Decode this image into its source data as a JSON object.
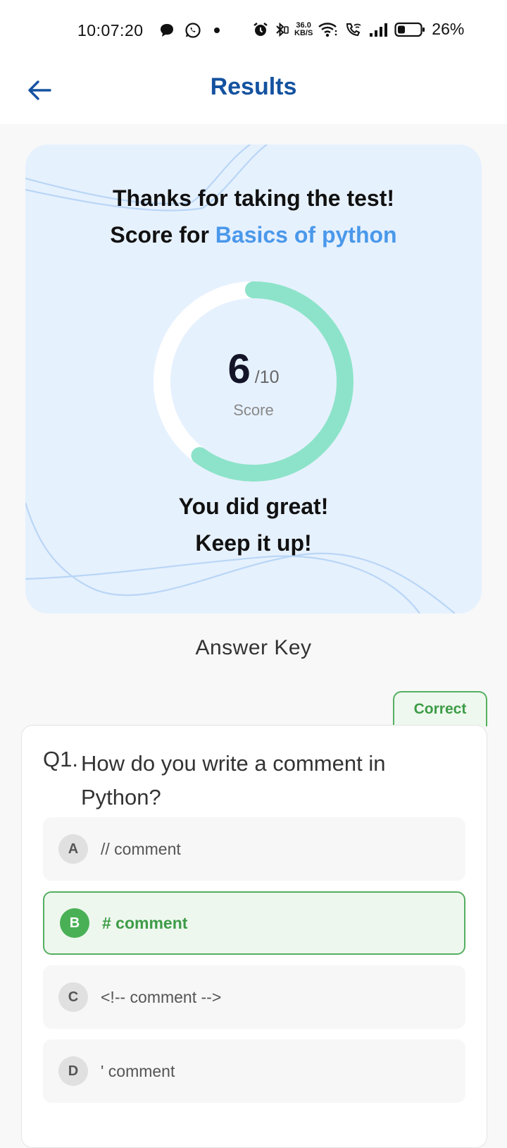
{
  "status_bar": {
    "time": "10:07:20",
    "net_speed_value": "36.0",
    "net_speed_unit": "KB/S",
    "battery": "26%"
  },
  "header": {
    "title": "Results"
  },
  "score_card": {
    "line1": "Thanks for taking the test!",
    "line2_prefix": "Score for ",
    "subject": "Basics of python",
    "score": "6",
    "total": "/10",
    "score_value": 6,
    "score_max": 10,
    "score_label": "Score",
    "message1": "You did great!",
    "message2": "Keep it up!"
  },
  "answer_key": {
    "title": "Answer Key",
    "questions": [
      {
        "number": "Q1.",
        "text": "How do you write a comment in Python?",
        "status": "Correct",
        "options": [
          {
            "letter": "A",
            "text": "// comment"
          },
          {
            "letter": "B",
            "text": "# comment"
          },
          {
            "letter": "C",
            "text": "<!-- comment -->"
          },
          {
            "letter": "D",
            "text": "' comment"
          }
        ]
      }
    ]
  },
  "colors": {
    "title_blue": "#1452a0",
    "subject_blue": "#4a98ea",
    "card_bg": "#e6f1fe",
    "ring_progress": "#8de3c9",
    "correct_green": "#4ab056"
  }
}
